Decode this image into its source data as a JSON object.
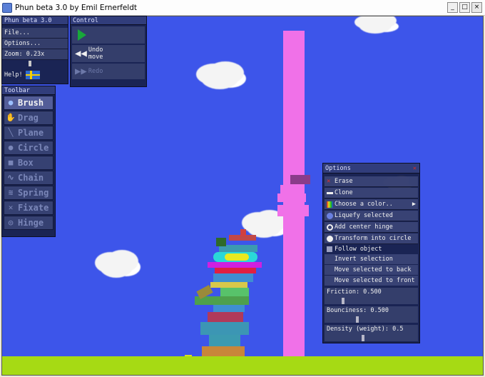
{
  "window": {
    "title": "Phun beta 3.0 by Emil Ernerfeldt",
    "buttons": [
      "_",
      "□",
      "×"
    ]
  },
  "main_panel": {
    "title": "Phun beta 3.0",
    "file_label": "File...",
    "options_label": "Options...",
    "zoom_label": "Zoom: 0.23x",
    "help_label": "Help!",
    "flag_icon": "swedish-flag-icon"
  },
  "control_panel": {
    "title": "Control",
    "play_icon": "play-icon",
    "undo_label": "Undo move",
    "redo_label": "Redo"
  },
  "toolbar": {
    "title": "Toolbar",
    "tools": [
      {
        "label": "Brush",
        "icon": "brush-icon",
        "active": true
      },
      {
        "label": "Drag",
        "icon": "drag-icon",
        "active": false
      },
      {
        "label": "Plane",
        "icon": "plane-icon",
        "active": false
      },
      {
        "label": "Circle",
        "icon": "circle-icon",
        "active": false
      },
      {
        "label": "Box",
        "icon": "box-icon",
        "active": false
      },
      {
        "label": "Chain",
        "icon": "chain-icon",
        "active": false
      },
      {
        "label": "Spring",
        "icon": "spring-icon",
        "active": false
      },
      {
        "label": "Fixate",
        "icon": "fixate-icon",
        "active": false
      },
      {
        "label": "Hinge",
        "icon": "hinge-icon",
        "active": false
      }
    ]
  },
  "options_panel": {
    "title": "Options",
    "close_icon": "close-icon",
    "erase_label": "Erase",
    "clone_label": "Clone",
    "choose_color_label": "Choose a color..",
    "liquefy_label": "Liquefy selected",
    "add_hinge_label": "Add center hinge",
    "transform_circle_label": "Transform into circle",
    "follow_label": "Follow object",
    "invert_label": "Invert selection",
    "move_back_label": "Move selected to back",
    "move_front_label": "Move selected to front",
    "friction_label": "Friction: 0.500",
    "bounciness_label": "Bounciness: 0.500",
    "density_label": "Density (weight): 0.5"
  },
  "colors": {
    "sky": "#3d55ea",
    "ground": "#a6da14",
    "tower": "#f071e8",
    "panel": "#182048"
  }
}
